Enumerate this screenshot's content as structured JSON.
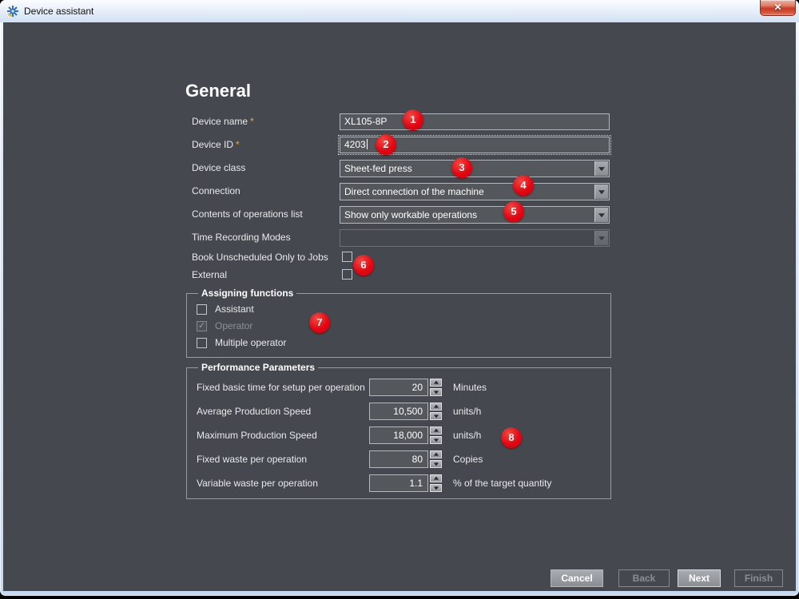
{
  "window": {
    "title": "Device assistant"
  },
  "icons": {
    "close_glyph": "✕",
    "check_glyph": "✓"
  },
  "page": {
    "heading": "General",
    "required_marker": "*"
  },
  "fields": [
    {
      "label": "Device name",
      "required": true,
      "type": "text",
      "value": "XL105-8P"
    },
    {
      "label": "Device ID",
      "required": true,
      "type": "text",
      "value": "4203",
      "focused": true
    },
    {
      "label": "Device class",
      "type": "dropdown",
      "value": "Sheet-fed press"
    },
    {
      "label": "Connection",
      "type": "dropdown",
      "value": "Direct connection of the machine"
    },
    {
      "label": "Contents of operations list",
      "type": "dropdown",
      "value": "Show only workable operations"
    },
    {
      "label": "Time Recording Modes",
      "type": "dropdown",
      "value": "",
      "disabled": true
    }
  ],
  "checkboxes": [
    {
      "label": "Book Unscheduled Only to Jobs",
      "checked": false
    },
    {
      "label": "External",
      "checked": false
    }
  ],
  "assigning_functions": {
    "title": "Assigning functions",
    "items": [
      {
        "label": "Assistant",
        "checked": false,
        "disabled": false
      },
      {
        "label": "Operator",
        "checked": true,
        "disabled": true
      },
      {
        "label": "Multiple operator",
        "checked": false,
        "disabled": false
      }
    ]
  },
  "performance_parameters": {
    "title": "Performance Parameters",
    "rows": [
      {
        "label": "Fixed basic time for setup per operation",
        "value": "20",
        "unit": "Minutes"
      },
      {
        "label": "Average Production Speed",
        "value": "10,500",
        "unit": "units/h"
      },
      {
        "label": "Maximum Production Speed",
        "value": "18,000",
        "unit": "units/h"
      },
      {
        "label": "Fixed waste per operation",
        "value": "80",
        "unit": "Copies"
      },
      {
        "label": "Variable waste per operation",
        "value": "1.1",
        "unit": "% of the target quantity"
      }
    ]
  },
  "footer": {
    "cancel_label": "Cancel",
    "back_label": "Back",
    "next_label": "Next",
    "finish_label": "Finish"
  },
  "badges": [
    "1",
    "2",
    "3",
    "4",
    "5",
    "6",
    "7",
    "8"
  ],
  "colors": {
    "content_bg": "#45484e",
    "field_bg": "#54575c",
    "titlebar_top": "#fbfdff",
    "titlebar_bottom": "#d2e0f3",
    "badge_red": "#e30613",
    "required_star": "#f0a93a",
    "disabled_text": "#8e9196",
    "close_button_red": "#c63a22"
  }
}
